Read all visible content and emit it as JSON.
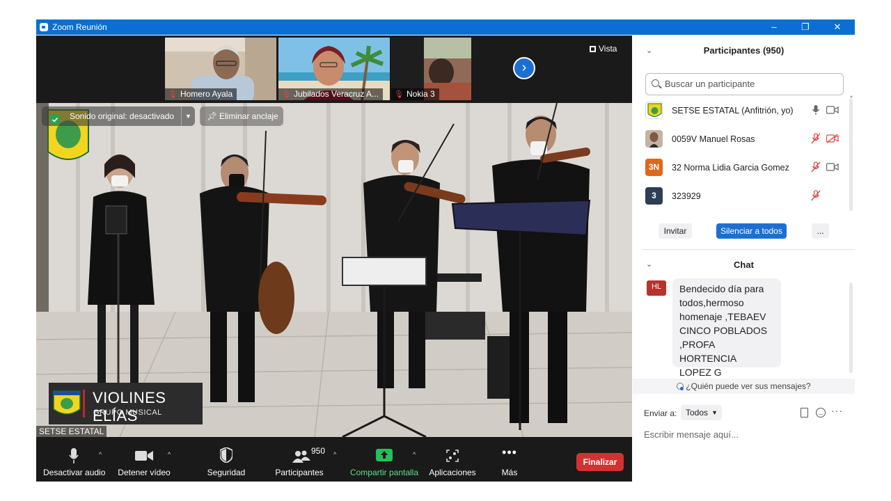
{
  "window": {
    "title": "Zoom Reunión"
  },
  "thumbnails": [
    {
      "name": "Homero Ayala"
    },
    {
      "name": "Jubilados Veracruz A..."
    },
    {
      "name": "Nokia 3"
    }
  ],
  "view": {
    "label": "Vista"
  },
  "video": {
    "sound_label": "Sonido original: desactivado",
    "unpin_label": "Eliminar anclaje",
    "lower_third_title": "VIOLINES ELÍAS",
    "lower_third_subtitle": "GRUPO MUSICAL",
    "speaker_name": "SETSE ESTATAL"
  },
  "toolbar": {
    "mute_label": "Desactivar audio",
    "video_label": "Detener vídeo",
    "security_label": "Seguridad",
    "participants_label": "Participantes",
    "participants_count": "950",
    "share_label": "Compartir pantalla",
    "apps_label": "Aplicaciones",
    "more_label": "Más",
    "end_label": "Finalizar"
  },
  "participants_panel": {
    "title": "Participantes (950)",
    "search_placeholder": "Buscar un participante",
    "rows": [
      {
        "name": "SETSE ESTATAL (Anfitrión, yo)",
        "avatar_text": "",
        "avatar_color": "#ffffff",
        "mic": "on",
        "camera": "on"
      },
      {
        "name": "0059V Manuel Rosas",
        "avatar_text": "",
        "avatar_color": "#5a4a3a",
        "mic": "muted",
        "camera": "off"
      },
      {
        "name": "32 Norma Lidia Garcia Gomez",
        "avatar_text": "3N",
        "avatar_color": "#e0681a",
        "mic": "muted",
        "camera": "on"
      },
      {
        "name": "323929",
        "avatar_text": "3",
        "avatar_color": "#2d3f55",
        "mic": "muted",
        "camera": "none"
      }
    ],
    "invite_label": "Invitar",
    "mute_all_label": "Silenciar a todos",
    "more_label": "..."
  },
  "chat": {
    "title": "Chat",
    "message": {
      "avatar_text": "HL",
      "lines": [
        "Bendecido día para",
        "todos,hermoso",
        "homenaje ,TEBAEV",
        "CINCO POBLADOS",
        ",PROFA HORTENCIA",
        "LOPEZ G"
      ]
    },
    "who_sees_label": "¿Quién puede ver sus mensajes?",
    "send_to_label": "Enviar a:",
    "send_to_value": "Todos",
    "input_placeholder": "Escribir mensaje aquí..."
  },
  "colors": {
    "titlebar": "#0b6fd1",
    "accent": "#1b6fd3",
    "end_button": "#d43131",
    "share_green": "#21c05a",
    "muted_red": "#e04848"
  }
}
